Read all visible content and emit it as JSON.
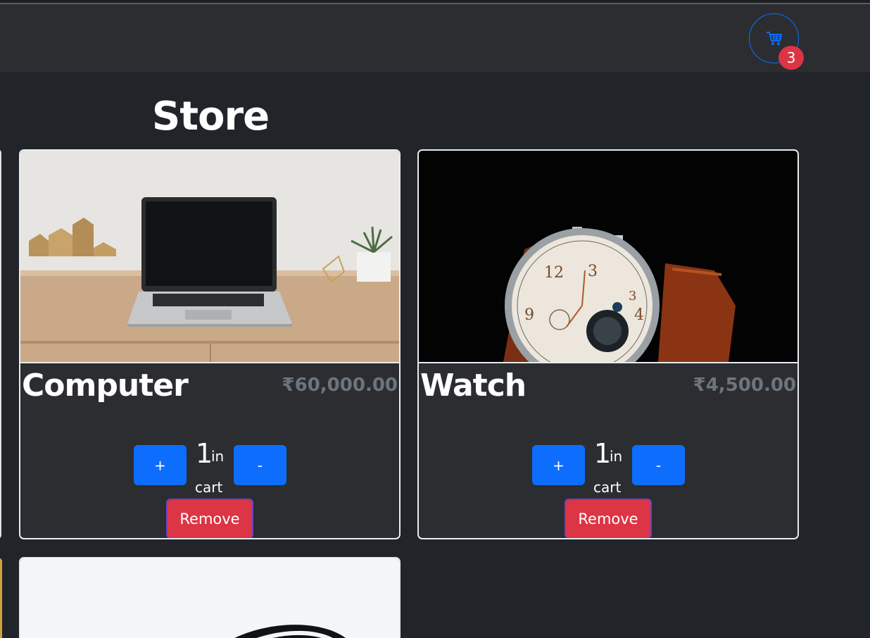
{
  "header": {
    "cart_count": "3",
    "cart_icon": "cart-icon"
  },
  "store": {
    "title": "Store"
  },
  "products": [
    {
      "name": "Computer",
      "price": "₹60,000.00",
      "qty": "1",
      "in_label": "in",
      "cart_label": "cart",
      "plus_label": "+",
      "minus_label": "-",
      "remove_label": "Remove"
    },
    {
      "name": "Watch",
      "price": "₹4,500.00",
      "qty": "1",
      "in_label": "in",
      "cart_label": "cart",
      "plus_label": "+",
      "minus_label": "-",
      "remove_label": "Remove"
    }
  ],
  "colors": {
    "background": "#212529",
    "navbar": "#2b2d31",
    "primary": "#0d6efd",
    "danger": "#dc3545",
    "muted": "#6c757d"
  }
}
